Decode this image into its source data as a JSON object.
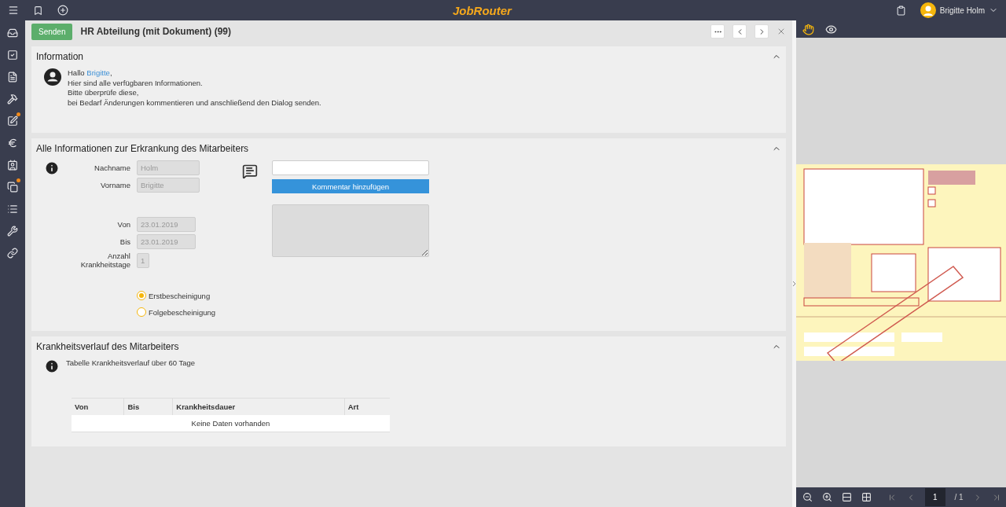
{
  "topbar": {
    "logo": "JobRouter",
    "user": {
      "name": "Brigitte Holm"
    }
  },
  "sidebar": {
    "items": [
      {
        "notification": false
      },
      {
        "notification": false
      },
      {
        "notification": false
      },
      {
        "notification": false
      },
      {
        "notification": true
      },
      {
        "notification": false
      },
      {
        "notification": false
      },
      {
        "notification": true
      },
      {
        "notification": false
      },
      {
        "notification": false
      },
      {
        "notification": false
      }
    ]
  },
  "header": {
    "send_button": "Senden",
    "title": "HR Abteilung (mit Dokument) (99)"
  },
  "information": {
    "title": "Information",
    "expanded": true,
    "greeting": "Hallo ",
    "user_link": "Brigitte",
    "greeting_end": ",",
    "lines": [
      "Hier sind alle verfügbaren Informationen.",
      "Bitte überprüfe diese,",
      "bei Bedarf Änderungen kommentieren und anschließend den Dialog senden."
    ]
  },
  "illness": {
    "title": "Alle Informationen zur Erkrankung des Mitarbeiters",
    "expanded": true,
    "fields": [
      {
        "label": "Nachname",
        "value": "Holm",
        "disabled": true
      },
      {
        "label": "Vorname",
        "value": "Brigitte",
        "disabled": true
      },
      {
        "label": "Von",
        "value": "23.01.2019",
        "disabled": true
      },
      {
        "label": "Bis",
        "value": "23.01.2019",
        "disabled": true
      },
      {
        "label": "Anzahl Krankheitstage",
        "value": "1",
        "disabled": true
      }
    ],
    "options": [
      {
        "label": "Erstbescheinigung",
        "selected": true
      },
      {
        "label": "Folgebescheinigung",
        "selected": false
      }
    ],
    "comment": {
      "button": "Kommentar hinzufügen",
      "history_disabled": true
    }
  },
  "history": {
    "title": "Krankheitsverlauf des Mitarbeiters",
    "expanded": true,
    "note": "Tabelle Krankheitsverlauf über 60 Tage",
    "table": {
      "columns": [
        "Von",
        "Bis",
        "Krankheitsdauer",
        "Art"
      ],
      "empty": "Keine Daten vorhanden"
    }
  },
  "viewer": {
    "page": "1",
    "page_count": "/ 1"
  }
}
